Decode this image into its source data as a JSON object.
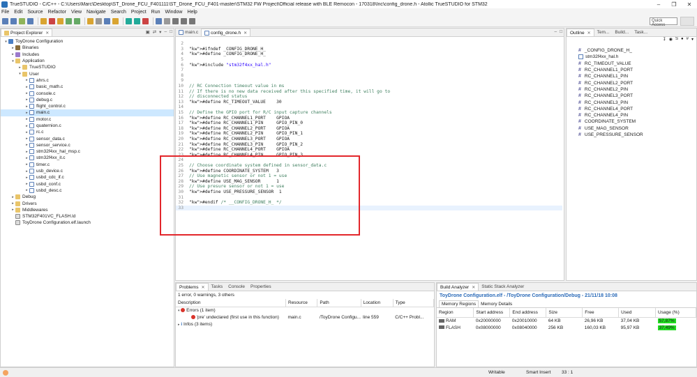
{
  "window": {
    "title": "TrueSTUDIO - C/C++ - C:\\Users\\Marc\\Desktop\\ST_Drone_FCU_F401111\\ST_Drone_FCU_F401-master\\STM32 FW Project\\Official release with BLE Remocon - 170318\\Inc\\config_drone.h - Atollic TrueSTUDIO for STM32",
    "minimize": "–",
    "maximize": "❐",
    "close": "✕"
  },
  "menu": [
    "File",
    "Edit",
    "Source",
    "Refactor",
    "View",
    "Navigate",
    "Search",
    "Project",
    "Run",
    "Window",
    "Help"
  ],
  "toolbar": {
    "quick_access": "Quick Access"
  },
  "project_explorer": {
    "tab": "Project Explorer",
    "tree": [
      {
        "label": "ToyDrone Configuration",
        "indent": 0,
        "arrow": "▾",
        "icon": "proj"
      },
      {
        "label": "Binaries",
        "indent": 1,
        "arrow": "▸",
        "icon": "bin"
      },
      {
        "label": "Includes",
        "indent": 1,
        "arrow": "▸",
        "icon": "inc"
      },
      {
        "label": "Application",
        "indent": 1,
        "arrow": "▾",
        "icon": "folder"
      },
      {
        "label": "TrueSTUDIO",
        "indent": 2,
        "arrow": "▸",
        "icon": "folder"
      },
      {
        "label": "User",
        "indent": 2,
        "arrow": "▾",
        "icon": "folder"
      },
      {
        "label": "ahrs.c",
        "indent": 3,
        "arrow": "▸",
        "icon": "cfile"
      },
      {
        "label": "basic_math.c",
        "indent": 3,
        "arrow": "▸",
        "icon": "cfile"
      },
      {
        "label": "console.c",
        "indent": 3,
        "arrow": "▸",
        "icon": "cfile"
      },
      {
        "label": "debug.c",
        "indent": 3,
        "arrow": "▸",
        "icon": "cfile"
      },
      {
        "label": "flight_control.c",
        "indent": 3,
        "arrow": "▸",
        "icon": "cfile"
      },
      {
        "label": "main.c",
        "indent": 3,
        "arrow": "▸",
        "icon": "cfile",
        "selected": true
      },
      {
        "label": "motor.c",
        "indent": 3,
        "arrow": "▸",
        "icon": "cfile"
      },
      {
        "label": "quaternion.c",
        "indent": 3,
        "arrow": "▸",
        "icon": "cfile"
      },
      {
        "label": "rc.c",
        "indent": 3,
        "arrow": "▸",
        "icon": "cfile"
      },
      {
        "label": "sensor_data.c",
        "indent": 3,
        "arrow": "▸",
        "icon": "cfile"
      },
      {
        "label": "sensor_service.c",
        "indent": 3,
        "arrow": "▸",
        "icon": "cfile"
      },
      {
        "label": "stm32f4xx_hal_msp.c",
        "indent": 3,
        "arrow": "▸",
        "icon": "cfile"
      },
      {
        "label": "stm32f4xx_it.c",
        "indent": 3,
        "arrow": "▸",
        "icon": "cfile"
      },
      {
        "label": "timer.c",
        "indent": 3,
        "arrow": "▸",
        "icon": "cfile"
      },
      {
        "label": "usb_device.c",
        "indent": 3,
        "arrow": "▸",
        "icon": "cfile"
      },
      {
        "label": "usbd_cdc_if.c",
        "indent": 3,
        "arrow": "▸",
        "icon": "cfile"
      },
      {
        "label": "usbd_conf.c",
        "indent": 3,
        "arrow": "▸",
        "icon": "cfile"
      },
      {
        "label": "usbd_desc.c",
        "indent": 3,
        "arrow": "▸",
        "icon": "cfile"
      },
      {
        "label": "Debug",
        "indent": 1,
        "arrow": "▸",
        "icon": "folder"
      },
      {
        "label": "Drivers",
        "indent": 1,
        "arrow": "▸",
        "icon": "folder"
      },
      {
        "label": "Middlewares",
        "indent": 1,
        "arrow": "▸",
        "icon": "folder"
      },
      {
        "label": "STM32F401VC_FLASH.ld",
        "indent": 1,
        "arrow": "",
        "icon": "lfile"
      },
      {
        "label": "ToyDrone Configuration.elf.launch",
        "indent": 1,
        "arrow": "",
        "icon": "lfile"
      }
    ]
  },
  "editor": {
    "tabs": [
      {
        "label": "main.c",
        "active": false
      },
      {
        "label": "config_drone.h",
        "active": true
      }
    ],
    "lines": [
      {
        "n": "2",
        "t": ""
      },
      {
        "n": "3",
        "t": "#ifndef _CONFIG_DRONE_H_"
      },
      {
        "n": "4",
        "t": "#define _CONFIG_DRONE_H_"
      },
      {
        "n": "5",
        "t": ""
      },
      {
        "n": "6",
        "t": "#include \"stm32f4xx_hal.h\""
      },
      {
        "n": "7",
        "t": ""
      },
      {
        "n": "8",
        "t": ""
      },
      {
        "n": "9",
        "t": ""
      },
      {
        "n": "10",
        "t": "// RC Connection timeout value in ms"
      },
      {
        "n": "11",
        "t": "// If there is no new data received after this specified time, it will go to"
      },
      {
        "n": "12",
        "t": "// disconnected status"
      },
      {
        "n": "13",
        "t": "#define RC_TIMEOUT_VALUE    30"
      },
      {
        "n": "14",
        "t": ""
      },
      {
        "n": "15",
        "t": "// Define the GPIO port for R/C input capture channels"
      },
      {
        "n": "16",
        "t": "#define RC_CHANNEL1_PORT    GPIOA"
      },
      {
        "n": "17",
        "t": "#define RC_CHANNEL1_PIN     GPIO_PIN_0"
      },
      {
        "n": "18",
        "t": "#define RC_CHANNEL2_PORT    GPIOA"
      },
      {
        "n": "19",
        "t": "#define RC_CHANNEL2_PIN     GPIO_PIN_1"
      },
      {
        "n": "20",
        "t": "#define RC_CHANNEL3_PORT    GPIOA"
      },
      {
        "n": "21",
        "t": "#define RC_CHANNEL3_PIN     GPIO_PIN_2"
      },
      {
        "n": "22",
        "t": "#define RC_CHANNEL4_PORT    GPIOA"
      },
      {
        "n": "23",
        "t": "#define RC_CHANNEL4_PIN     GPIO_PIN_3"
      },
      {
        "n": "24",
        "t": ""
      },
      {
        "n": "25",
        "t": "// Choose coordinate system defined in sensor_data.c"
      },
      {
        "n": "26",
        "t": "#define COORDINATE_SYSTEM   3"
      },
      {
        "n": "27",
        "t": "// Use magnetic sensor or not 1 = use"
      },
      {
        "n": "28",
        "t": "#define USE_MAG_SENSOR      1"
      },
      {
        "n": "29",
        "t": "// Use presure sensor or not 1 = use"
      },
      {
        "n": "30",
        "t": "#define USE_PRESSURE_SENSOR  1"
      },
      {
        "n": "31",
        "t": ""
      },
      {
        "n": "32",
        "t": "#endif /* __CONFIG_DRONE_H_ */"
      },
      {
        "n": "33",
        "t": ""
      }
    ]
  },
  "outline": {
    "tabs": [
      "Outline",
      "Tem...",
      "Build...",
      "Task..."
    ],
    "items": [
      {
        "label": "_CONFIG_DRONE_H_",
        "kind": "define"
      },
      {
        "label": "stm32f4xx_hal.h",
        "kind": "include"
      },
      {
        "label": "RC_TIMEOUT_VALUE",
        "kind": "define"
      },
      {
        "label": "RC_CHANNEL1_PORT",
        "kind": "define"
      },
      {
        "label": "RC_CHANNEL1_PIN",
        "kind": "define"
      },
      {
        "label": "RC_CHANNEL2_PORT",
        "kind": "define"
      },
      {
        "label": "RC_CHANNEL2_PIN",
        "kind": "define"
      },
      {
        "label": "RC_CHANNEL3_PORT",
        "kind": "define"
      },
      {
        "label": "RC_CHANNEL3_PIN",
        "kind": "define"
      },
      {
        "label": "RC_CHANNEL4_PORT",
        "kind": "define"
      },
      {
        "label": "RC_CHANNEL4_PIN",
        "kind": "define"
      },
      {
        "label": "COORDINATE_SYSTEM",
        "kind": "define"
      },
      {
        "label": "USE_MAG_SENSOR",
        "kind": "define"
      },
      {
        "label": "USE_PRESSURE_SENSOR",
        "kind": "define"
      }
    ]
  },
  "problems": {
    "tabs": [
      "Problems",
      "Tasks",
      "Console",
      "Properties"
    ],
    "summary": "1 error, 0 warnings, 3 others",
    "columns": [
      "Description",
      "Resource",
      "Path",
      "Location",
      "Type"
    ],
    "errors_group": "Errors (1 item)",
    "error_row": {
      "description": "'pre' undeclared (first use in this function)",
      "resource": "main.c",
      "path": "/ToyDrone Configu...",
      "location": "line 559",
      "type": "C/C++ Probl..."
    },
    "infos_group": "Infos (3 items)"
  },
  "build_analyzer": {
    "tabs": [
      "Build Analyzer",
      "Static Stack Analyzer"
    ],
    "heading": "ToyDrone Configuration.elf - /ToyDrone Configuration/Debug - 21/11/18 10:08",
    "subtabs": [
      "Memory Regions",
      "Memory Details"
    ],
    "columns": [
      "Region",
      "Start address",
      "End address",
      "Size",
      "Free",
      "Used",
      "Usage (%)"
    ],
    "rows": [
      {
        "region": "RAM",
        "start": "0x20000000",
        "end": "0x20010000",
        "size": "64 KB",
        "free": "26,96 KB",
        "used": "37,04 KB",
        "usage": "57,87%"
      },
      {
        "region": "FLASH",
        "start": "0x08000000",
        "end": "0x08040000",
        "size": "256 KB",
        "free": "160,03 KB",
        "used": "95,97 KB",
        "usage": "37,49%"
      }
    ]
  },
  "statusbar": {
    "writable": "Writable",
    "insert_mode": "Smart Insert",
    "position": "33 : 1"
  }
}
